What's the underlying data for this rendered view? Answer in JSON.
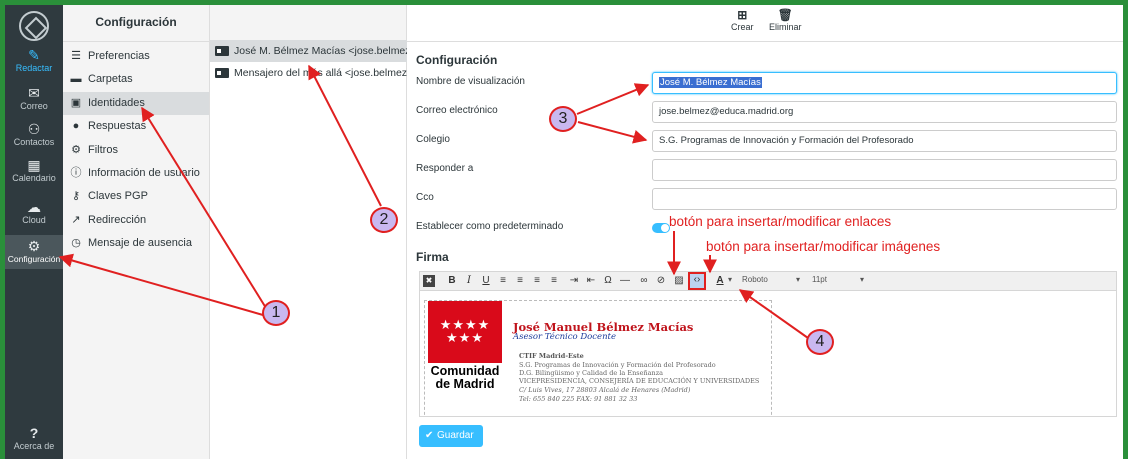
{
  "rail": {
    "items": [
      {
        "label": "Redactar",
        "icon": "compose-icon",
        "glyph": "✎"
      },
      {
        "label": "Correo",
        "icon": "mail-icon",
        "glyph": "✉"
      },
      {
        "label": "Contactos",
        "icon": "contacts-icon",
        "glyph": "👥"
      },
      {
        "label": "Calendario",
        "icon": "calendar-icon",
        "glyph": "▦"
      },
      {
        "label": "Cloud",
        "icon": "cloud-icon",
        "glyph": "☁"
      },
      {
        "label": "Configuración",
        "icon": "gear-icon",
        "glyph": "⚙"
      },
      {
        "label": "Acerca de",
        "icon": "question-icon",
        "glyph": "?"
      }
    ]
  },
  "settings": {
    "header": "Configuración",
    "items": [
      {
        "label": "Preferencias",
        "icon": "sliders-icon",
        "glyph": "☰"
      },
      {
        "label": "Carpetas",
        "icon": "folder-icon",
        "glyph": "▬"
      },
      {
        "label": "Identidades",
        "icon": "id-card-icon",
        "glyph": "▣"
      },
      {
        "label": "Respuestas",
        "icon": "comment-icon",
        "glyph": "●"
      },
      {
        "label": "Filtros",
        "icon": "gear-icon",
        "glyph": "⚙"
      },
      {
        "label": "Información de usuario",
        "icon": "info-icon",
        "glyph": "ⓘ"
      },
      {
        "label": "Claves PGP",
        "icon": "key-icon",
        "glyph": "⚷"
      },
      {
        "label": "Redirección",
        "icon": "forward-icon",
        "glyph": "↗"
      },
      {
        "label": "Mensaje de ausencia",
        "icon": "clock-icon",
        "glyph": "◷"
      }
    ]
  },
  "identities": {
    "items": [
      {
        "label": "José M. Bélmez Macías <jose.belmez@..."
      },
      {
        "label": "Mensajero del más allá <jose.belmez@..."
      }
    ]
  },
  "toolbar": {
    "create_label": "Crear",
    "delete_label": "Eliminar"
  },
  "form": {
    "section_title": "Configuración",
    "display_name_label": "Nombre de visualización",
    "display_name_value": "José M. Bélmez Macías",
    "email_label": "Correo electrónico",
    "email_value": "jose.belmez@educa.madrid.org",
    "org_label": "Colegio",
    "org_value": "S.G. Programas de Innovación y Formación del Profesorado",
    "reply_to_label": "Responder a",
    "reply_to_value": "",
    "bcc_label": "Cco",
    "bcc_value": "",
    "default_label": "Establecer como predeterminado",
    "default_on": true,
    "signature_title": "Firma",
    "save_label": "Guardar"
  },
  "editor": {
    "font": "Roboto",
    "size": "11pt",
    "text_color_label": "A",
    "buttons": [
      {
        "name": "clear-format-icon",
        "glyph": "✖"
      },
      {
        "name": "bold-icon",
        "glyph": "B"
      },
      {
        "name": "italic-icon",
        "glyph": "I"
      },
      {
        "name": "underline-icon",
        "glyph": "U"
      },
      {
        "name": "align-left-icon",
        "glyph": "≡"
      },
      {
        "name": "align-center-icon",
        "glyph": "≡"
      },
      {
        "name": "align-right-icon",
        "glyph": "≡"
      },
      {
        "name": "align-justify-icon",
        "glyph": "≡"
      },
      {
        "name": "indent-icon",
        "glyph": "⇥"
      },
      {
        "name": "outdent-icon",
        "glyph": "⇤"
      },
      {
        "name": "special-char-icon",
        "glyph": "Ω"
      },
      {
        "name": "horizontal-rule-icon",
        "glyph": "—"
      },
      {
        "name": "link-icon",
        "glyph": "🔗"
      },
      {
        "name": "unlink-icon",
        "glyph": "⊘"
      },
      {
        "name": "image-icon",
        "glyph": "▨"
      },
      {
        "name": "source-code-icon",
        "glyph": "‹›"
      }
    ]
  },
  "signature": {
    "logo_stars": "★★★★\n★★★",
    "logo_text": "Comunidad\nde Madrid",
    "name": "José Manuel Bélmez Macías",
    "role": "Asesor Técnico Docente",
    "org": "CTIF Madrid-Este",
    "line1": "S.G. Programas de Innovación y Formación del Profesorado",
    "line2": "D.G. Bilingüismo y Calidad de la Enseñanza",
    "line3": "VICEPRESIDENCIA, CONSEJERÍA DE EDUCACIÓN Y UNIVERSIDADES",
    "address": "C/ Luis Vives, 17  28803 Alcalá de Henares (Madrid)",
    "phone": "Tel: 655 840 225   FAX: 91 881 32 33"
  },
  "annotations": {
    "link_label": "botón para insertar/modificar enlaces",
    "image_label": "botón para insertar/modificar imágenes",
    "badge1": "1",
    "badge2": "2",
    "badge3": "3",
    "badge4": "4",
    "color": "#e02020"
  }
}
